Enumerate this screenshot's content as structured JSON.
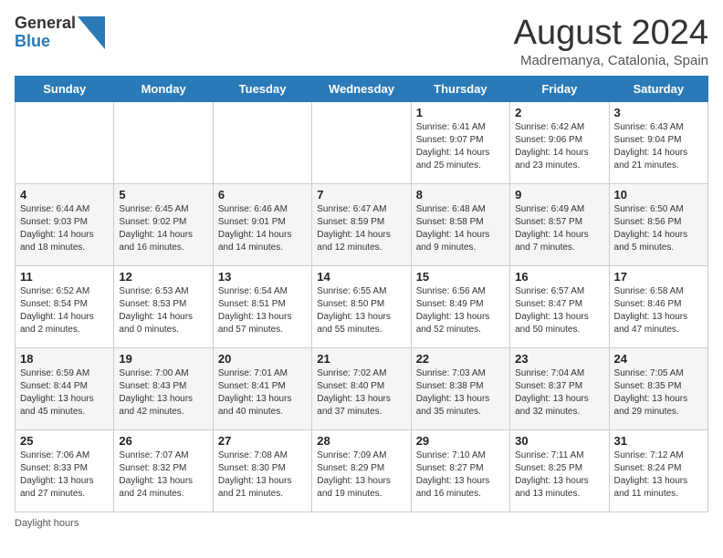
{
  "header": {
    "logo_general": "General",
    "logo_blue": "Blue",
    "month_title": "August 2024",
    "location": "Madremanya, Catalonia, Spain"
  },
  "days_of_week": [
    "Sunday",
    "Monday",
    "Tuesday",
    "Wednesday",
    "Thursday",
    "Friday",
    "Saturday"
  ],
  "weeks": [
    [
      {
        "day": "",
        "info": ""
      },
      {
        "day": "",
        "info": ""
      },
      {
        "day": "",
        "info": ""
      },
      {
        "day": "",
        "info": ""
      },
      {
        "day": "1",
        "info": "Sunrise: 6:41 AM\nSunset: 9:07 PM\nDaylight: 14 hours\nand 25 minutes."
      },
      {
        "day": "2",
        "info": "Sunrise: 6:42 AM\nSunset: 9:06 PM\nDaylight: 14 hours\nand 23 minutes."
      },
      {
        "day": "3",
        "info": "Sunrise: 6:43 AM\nSunset: 9:04 PM\nDaylight: 14 hours\nand 21 minutes."
      }
    ],
    [
      {
        "day": "4",
        "info": "Sunrise: 6:44 AM\nSunset: 9:03 PM\nDaylight: 14 hours\nand 18 minutes."
      },
      {
        "day": "5",
        "info": "Sunrise: 6:45 AM\nSunset: 9:02 PM\nDaylight: 14 hours\nand 16 minutes."
      },
      {
        "day": "6",
        "info": "Sunrise: 6:46 AM\nSunset: 9:01 PM\nDaylight: 14 hours\nand 14 minutes."
      },
      {
        "day": "7",
        "info": "Sunrise: 6:47 AM\nSunset: 8:59 PM\nDaylight: 14 hours\nand 12 minutes."
      },
      {
        "day": "8",
        "info": "Sunrise: 6:48 AM\nSunset: 8:58 PM\nDaylight: 14 hours\nand 9 minutes."
      },
      {
        "day": "9",
        "info": "Sunrise: 6:49 AM\nSunset: 8:57 PM\nDaylight: 14 hours\nand 7 minutes."
      },
      {
        "day": "10",
        "info": "Sunrise: 6:50 AM\nSunset: 8:56 PM\nDaylight: 14 hours\nand 5 minutes."
      }
    ],
    [
      {
        "day": "11",
        "info": "Sunrise: 6:52 AM\nSunset: 8:54 PM\nDaylight: 14 hours\nand 2 minutes."
      },
      {
        "day": "12",
        "info": "Sunrise: 6:53 AM\nSunset: 8:53 PM\nDaylight: 14 hours\nand 0 minutes."
      },
      {
        "day": "13",
        "info": "Sunrise: 6:54 AM\nSunset: 8:51 PM\nDaylight: 13 hours\nand 57 minutes."
      },
      {
        "day": "14",
        "info": "Sunrise: 6:55 AM\nSunset: 8:50 PM\nDaylight: 13 hours\nand 55 minutes."
      },
      {
        "day": "15",
        "info": "Sunrise: 6:56 AM\nSunset: 8:49 PM\nDaylight: 13 hours\nand 52 minutes."
      },
      {
        "day": "16",
        "info": "Sunrise: 6:57 AM\nSunset: 8:47 PM\nDaylight: 13 hours\nand 50 minutes."
      },
      {
        "day": "17",
        "info": "Sunrise: 6:58 AM\nSunset: 8:46 PM\nDaylight: 13 hours\nand 47 minutes."
      }
    ],
    [
      {
        "day": "18",
        "info": "Sunrise: 6:59 AM\nSunset: 8:44 PM\nDaylight: 13 hours\nand 45 minutes."
      },
      {
        "day": "19",
        "info": "Sunrise: 7:00 AM\nSunset: 8:43 PM\nDaylight: 13 hours\nand 42 minutes."
      },
      {
        "day": "20",
        "info": "Sunrise: 7:01 AM\nSunset: 8:41 PM\nDaylight: 13 hours\nand 40 minutes."
      },
      {
        "day": "21",
        "info": "Sunrise: 7:02 AM\nSunset: 8:40 PM\nDaylight: 13 hours\nand 37 minutes."
      },
      {
        "day": "22",
        "info": "Sunrise: 7:03 AM\nSunset: 8:38 PM\nDaylight: 13 hours\nand 35 minutes."
      },
      {
        "day": "23",
        "info": "Sunrise: 7:04 AM\nSunset: 8:37 PM\nDaylight: 13 hours\nand 32 minutes."
      },
      {
        "day": "24",
        "info": "Sunrise: 7:05 AM\nSunset: 8:35 PM\nDaylight: 13 hours\nand 29 minutes."
      }
    ],
    [
      {
        "day": "25",
        "info": "Sunrise: 7:06 AM\nSunset: 8:33 PM\nDaylight: 13 hours\nand 27 minutes."
      },
      {
        "day": "26",
        "info": "Sunrise: 7:07 AM\nSunset: 8:32 PM\nDaylight: 13 hours\nand 24 minutes."
      },
      {
        "day": "27",
        "info": "Sunrise: 7:08 AM\nSunset: 8:30 PM\nDaylight: 13 hours\nand 21 minutes."
      },
      {
        "day": "28",
        "info": "Sunrise: 7:09 AM\nSunset: 8:29 PM\nDaylight: 13 hours\nand 19 minutes."
      },
      {
        "day": "29",
        "info": "Sunrise: 7:10 AM\nSunset: 8:27 PM\nDaylight: 13 hours\nand 16 minutes."
      },
      {
        "day": "30",
        "info": "Sunrise: 7:11 AM\nSunset: 8:25 PM\nDaylight: 13 hours\nand 13 minutes."
      },
      {
        "day": "31",
        "info": "Sunrise: 7:12 AM\nSunset: 8:24 PM\nDaylight: 13 hours\nand 11 minutes."
      }
    ]
  ],
  "footer": {
    "daylight_label": "Daylight hours"
  }
}
